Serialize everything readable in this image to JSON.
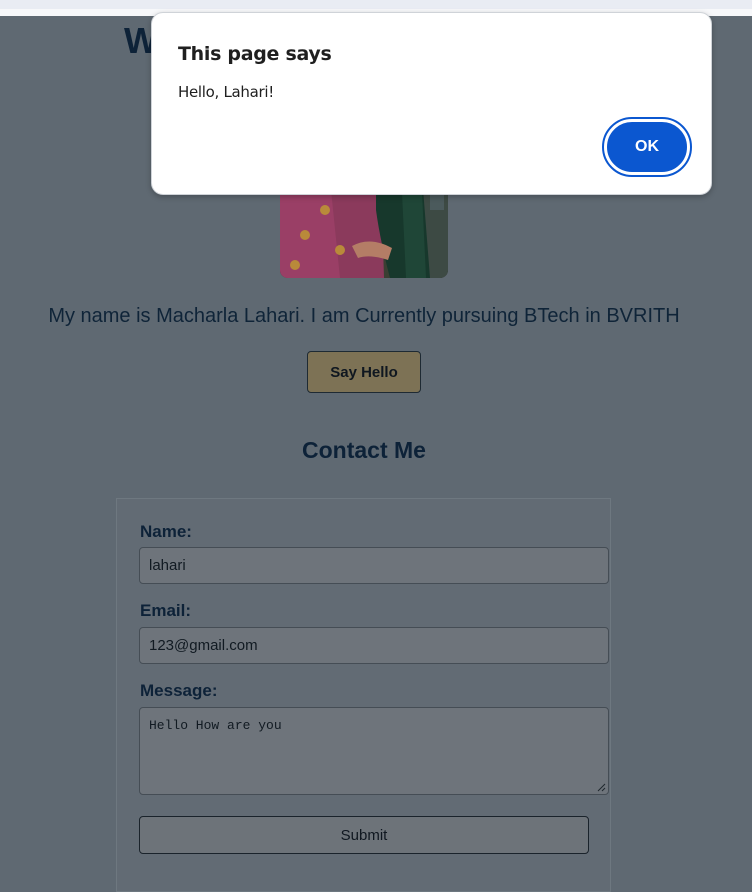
{
  "page": {
    "heading_visible_fragment": "W",
    "intro": "My name is Macharla Lahari. I am Currently pursuing BTech in BVRITH",
    "say_hello_label": "Say Hello",
    "contact_heading": "Contact Me"
  },
  "form": {
    "name_label": "Name:",
    "name_value": "lahari",
    "email_label": "Email:",
    "email_value": "123@gmail.com",
    "message_label": "Message:",
    "message_value": "Hello How are you",
    "submit_label": "Submit"
  },
  "dialog": {
    "title": "This page says",
    "message": "Hello, Lahari!",
    "ok_label": "OK"
  },
  "colors": {
    "overlay_page": "#5f6972",
    "heading": "#0d2238",
    "say_hello_bg": "#7d7255",
    "dialog_button": "#0b57d0"
  },
  "icons": {
    "textarea_resize": "resize-grip-icon"
  }
}
